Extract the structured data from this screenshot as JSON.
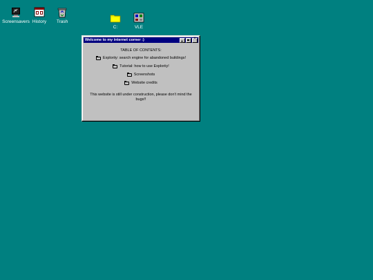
{
  "desktop": {
    "background": "#008080",
    "icons": [
      {
        "label": "Screensavers",
        "icon": "monitor-icon"
      },
      {
        "label": "History",
        "icon": "history-icon"
      },
      {
        "label": "Trash",
        "icon": "recycle-bin-icon"
      },
      {
        "label": "C:",
        "icon": "folder-icon"
      },
      {
        "label": "VLE",
        "icon": "control-panel-icon"
      }
    ]
  },
  "window": {
    "title": "Welcome to my internet corner :)",
    "titlebar_color": "#000080",
    "heading": "TABLE OF CONTENTS:",
    "items": [
      {
        "label": "Exploriiy: search engine for abandoned buildings!"
      },
      {
        "label": "Tutorial: how to use Exploriiy!"
      },
      {
        "label": "Screenshots"
      },
      {
        "label": "Website credits"
      }
    ],
    "notice": "This website is still under construction, please don't mind the bugs!!"
  }
}
